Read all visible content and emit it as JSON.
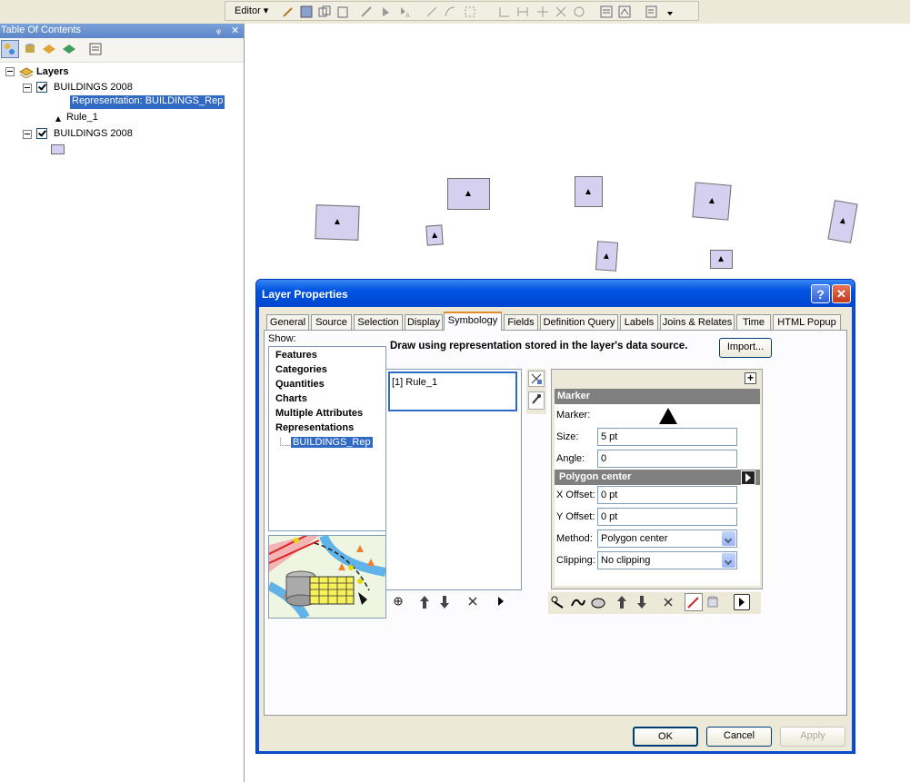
{
  "toolbar": {
    "editor_label": "Editor ▾"
  },
  "toc": {
    "title": "Table Of Contents",
    "pin": "ᵩ",
    "close": "✕",
    "root": "Layers",
    "layers": [
      {
        "name": "BUILDINGS 2008",
        "checked": true,
        "child": "Representation: BUILDINGS_Rep",
        "rule": "Rule_1"
      },
      {
        "name": "BUILDINGS 2008",
        "checked": true
      }
    ]
  },
  "dialog": {
    "title": "Layer Properties",
    "help": "?",
    "close": "✕",
    "tabs": [
      "General",
      "Source",
      "Selection",
      "Display",
      "Symbology",
      "Fields",
      "Definition Query",
      "Labels",
      "Joins & Relates",
      "Time",
      "HTML Popup"
    ],
    "active_tab": "Symbology",
    "show_label": "Show:",
    "show_items": [
      "Features",
      "Categories",
      "Quantities",
      "Charts",
      "Multiple Attributes",
      "Representations"
    ],
    "show_sub": "BUILDINGS_Rep",
    "description": "Draw using representation stored in the layer's data source.",
    "import_button": "Import...",
    "rules": [
      "[1] Rule_1"
    ],
    "props": {
      "marker_header": "Marker",
      "marker_label": "Marker:",
      "size_label": "Size:",
      "size_value": "5 pt",
      "angle_label": "Angle:",
      "angle_value": "0",
      "polygon_header": "Polygon center",
      "xoffset_label": "X Offset:",
      "xoffset_value": "0 pt",
      "yoffset_label": "Y Offset:",
      "yoffset_value": "0 pt",
      "method_label": "Method:",
      "method_value": "Polygon center",
      "clipping_label": "Clipping:",
      "clipping_value": "No clipping",
      "plus": "+"
    },
    "ok": "OK",
    "cancel": "Cancel",
    "apply": "Apply"
  }
}
